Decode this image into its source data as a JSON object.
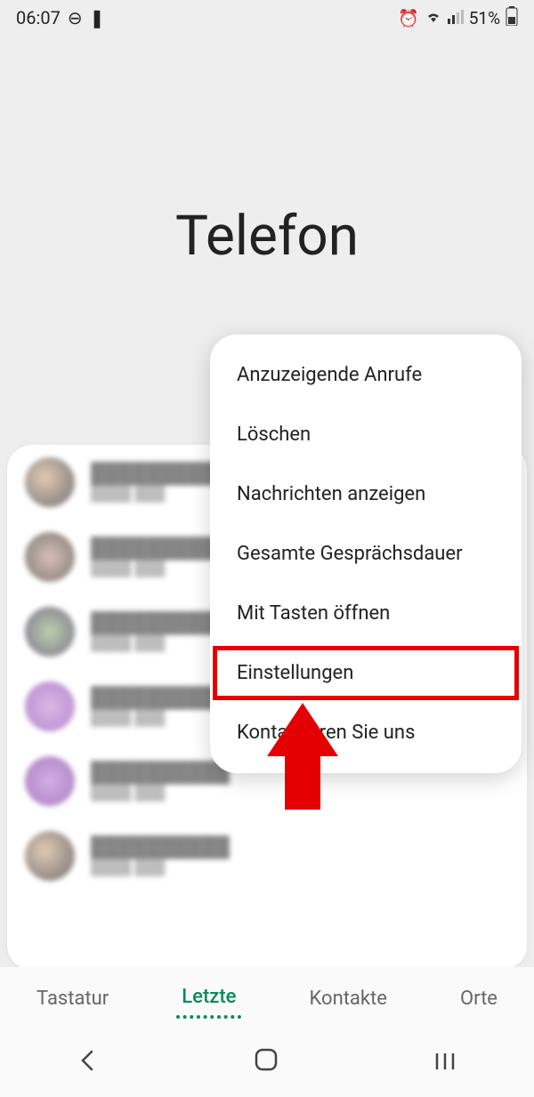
{
  "status": {
    "time": "06:07",
    "battery": "51%"
  },
  "app_title": "Telefon",
  "popup": {
    "items": [
      "Anzuzeigende Anrufe",
      "Löschen",
      "Nachrichten anzeigen",
      "Gesamte Gesprächsdauer",
      "Mit Tasten öffnen",
      "Einstellungen",
      "Kontaktieren Sie uns"
    ],
    "highlighted_index": 5
  },
  "tabs": {
    "items": [
      "Tastatur",
      "Letzte",
      "Kontakte",
      "Orte"
    ],
    "active_index": 1
  }
}
